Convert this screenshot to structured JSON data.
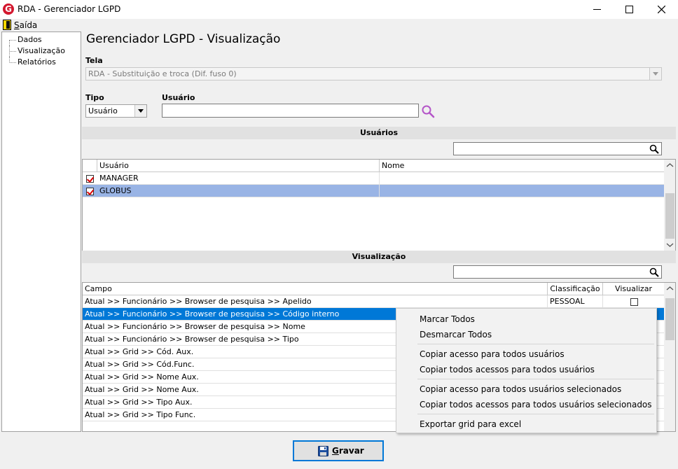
{
  "window": {
    "title": "RDA - Gerenciador LGPD"
  },
  "menu": {
    "exit_first": "S",
    "exit_rest": "aída"
  },
  "tree": {
    "items": [
      "Dados",
      "Visualização",
      "Relatórios"
    ]
  },
  "page": {
    "title": "Gerenciador LGPD - Visualização"
  },
  "form": {
    "tela_label": "Tela",
    "tela_value": "RDA - Substituição e troca (Dif. fuso 0)",
    "tipo_label": "Tipo",
    "tipo_value": "Usuário",
    "usuario_label": "Usuário",
    "usuario_value": ""
  },
  "users_section": {
    "title": "Usuários",
    "search_value": "",
    "columns": [
      "Usuário",
      "Nome"
    ],
    "rows": [
      {
        "usuario": "MANAGER",
        "nome": "",
        "checked": true,
        "selected": false
      },
      {
        "usuario": "GLOBUS",
        "nome": "",
        "checked": true,
        "selected": true
      }
    ]
  },
  "view_section": {
    "title": "Visualização",
    "search_value": "",
    "columns": [
      "Campo",
      "Classificação",
      "Visualizar"
    ],
    "rows": [
      {
        "campo": "Atual >> Funcionário >> Browser de pesquisa >> Apelido",
        "classificacao": "PESSOAL",
        "visualizar": false
      },
      {
        "campo": "Atual >> Funcionário >> Browser de pesquisa >> Código interno",
        "classificacao": "",
        "visualizar": false
      },
      {
        "campo": "Atual >> Funcionário >> Browser de pesquisa >> Nome",
        "classificacao": "",
        "visualizar": false
      },
      {
        "campo": "Atual >> Funcionário >> Browser de pesquisa >> Tipo",
        "classificacao": "",
        "visualizar": false
      },
      {
        "campo": "Atual >> Grid >> Cód. Aux.",
        "classificacao": "",
        "visualizar": false
      },
      {
        "campo": "Atual >> Grid >> Cód.Func.",
        "classificacao": "",
        "visualizar": false
      },
      {
        "campo": "Atual >> Grid >> Nome Aux.",
        "classificacao": "",
        "visualizar": false
      },
      {
        "campo": "Atual >> Grid >> Nome Aux.",
        "classificacao": "",
        "visualizar": false
      },
      {
        "campo": "Atual >> Grid >> Tipo Aux.",
        "classificacao": "",
        "visualizar": false
      },
      {
        "campo": "Atual >> Grid >> Tipo Func.",
        "classificacao": "",
        "visualizar": false
      }
    ]
  },
  "context_menu": {
    "groups": [
      [
        "Marcar Todos",
        "Desmarcar Todos"
      ],
      [
        "Copiar acesso para todos usuários",
        "Copiar todos acessos para todos usuários"
      ],
      [
        "Copiar acesso para todos usuários selecionados",
        "Copiar todos acessos para todos usuários selecionados"
      ],
      [
        "Exportar grid para excel"
      ]
    ]
  },
  "buttons": {
    "save_first": "G",
    "save_rest": "ravar"
  },
  "icons": {
    "app": "app-logo-icon",
    "exit": "exit-door-icon",
    "search": "magnifier-icon",
    "save": "floppy-disk-icon"
  },
  "colors": {
    "selection_light": "#99b4e5",
    "selection_dark": "#0078d7",
    "checkmark": "#dd0000",
    "search_accent": "#b455c8"
  }
}
